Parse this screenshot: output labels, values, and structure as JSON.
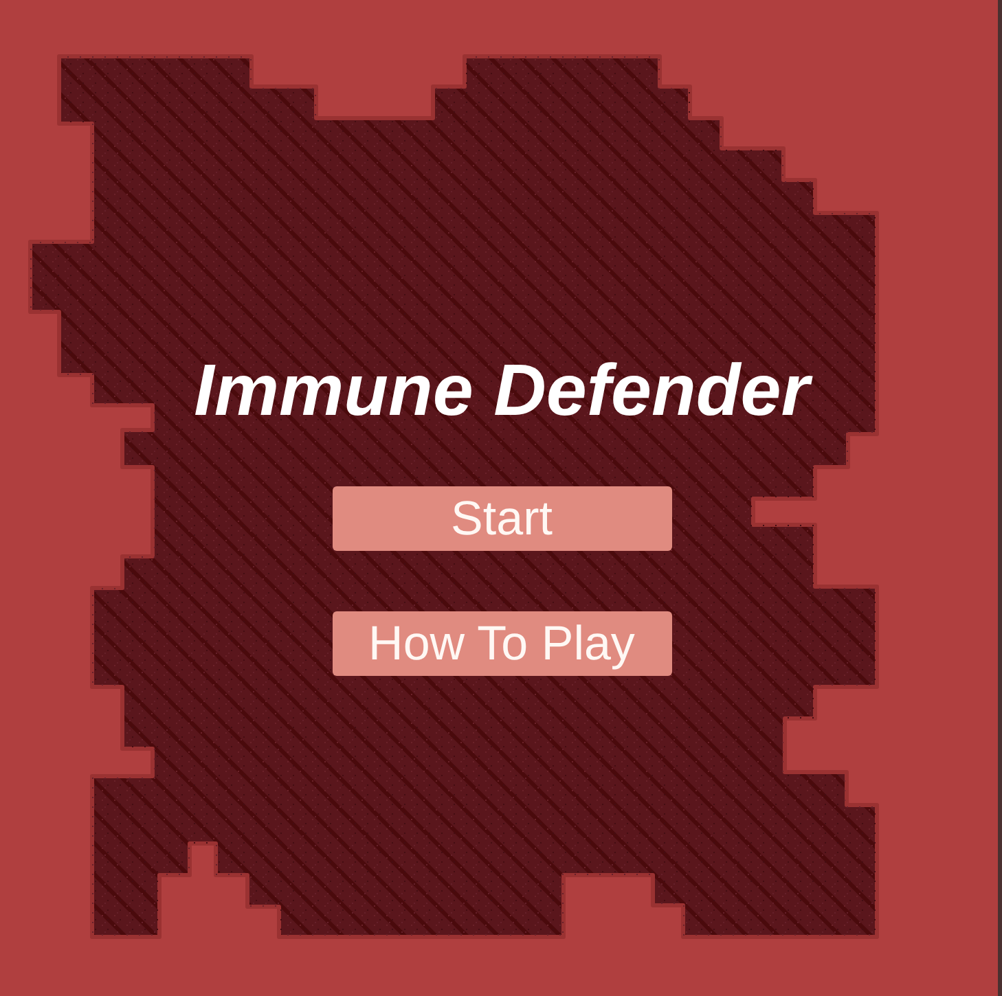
{
  "title": "Immune Defender",
  "buttons": [
    {
      "label": "Start"
    },
    {
      "label": "How To Play"
    }
  ]
}
